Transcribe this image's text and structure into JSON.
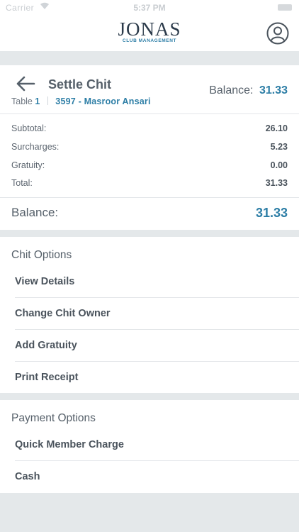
{
  "status_bar": {
    "carrier": "Carrier",
    "time": "5:37 PM"
  },
  "header": {
    "logo_text": "JONAS",
    "logo_tagline": "CLUB MANAGEMENT",
    "icons": {
      "profile": "user-circle-icon"
    }
  },
  "page": {
    "title": "Settle Chit",
    "table_label": "Table",
    "table_number": "1",
    "member": "3597 - Masroor Ansari",
    "balance_label": "Balance:",
    "balance_value": "31.33",
    "back_icon": "arrow-left-icon"
  },
  "summary": [
    {
      "label": "Subtotal:",
      "value": "26.10"
    },
    {
      "label": "Surcharges:",
      "value": "5.23"
    },
    {
      "label": "Gratuity:",
      "value": "0.00"
    },
    {
      "label": "Total:",
      "value": "31.33"
    }
  ],
  "balance": {
    "label": "Balance:",
    "value": "31.33"
  },
  "chit_options": {
    "title": "Chit Options",
    "items": [
      "View Details",
      "Change Chit Owner",
      "Add Gratuity",
      "Print Receipt"
    ]
  },
  "payment_options": {
    "title": "Payment Options",
    "items": [
      "Quick Member Charge",
      "Cash"
    ]
  },
  "colors": {
    "accent": "#2d7ea6",
    "background": "#e4e8ea",
    "text": "#4a535c"
  }
}
